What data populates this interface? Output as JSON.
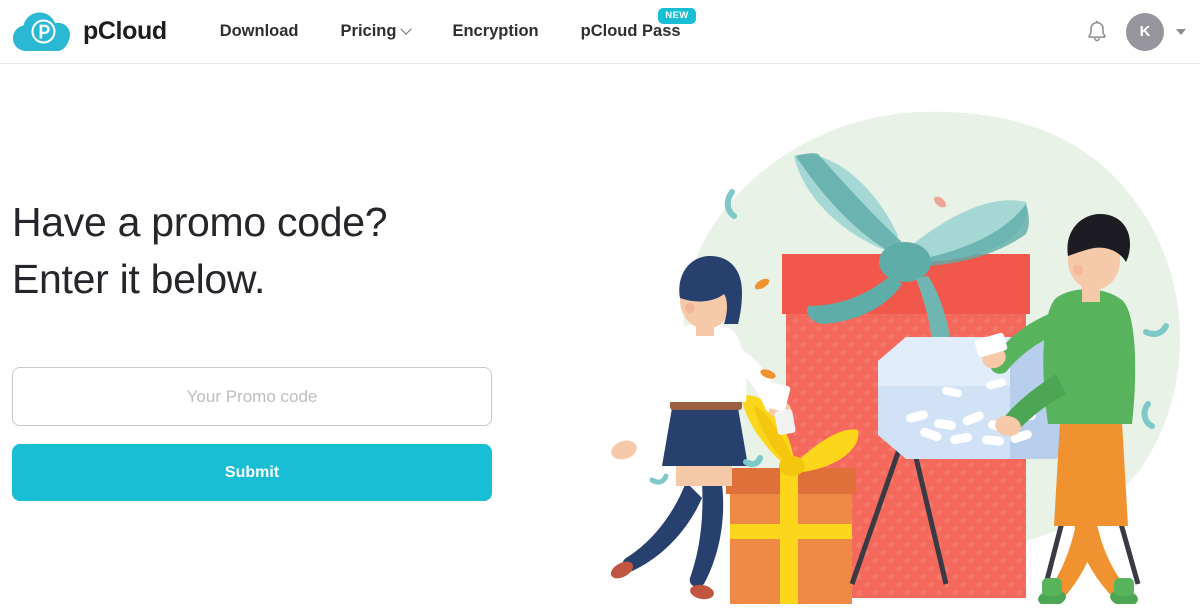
{
  "header": {
    "brand": {
      "name": "pCloud",
      "logo_icon": "pcloud-cloud-logo",
      "color": "#17bed4"
    },
    "nav": [
      {
        "label": "Download",
        "icon": null,
        "badge": null
      },
      {
        "label": "Pricing",
        "icon": "chevron-down-icon",
        "badge": null
      },
      {
        "label": "Encryption",
        "icon": null,
        "badge": null
      },
      {
        "label": "pCloud Pass",
        "icon": null,
        "badge": "NEW"
      }
    ],
    "notifications_icon": "bell-icon",
    "avatar": {
      "initial": "K",
      "color": "#95959b"
    },
    "account_caret_icon": "caret-down-icon"
  },
  "main": {
    "headline_line1": "Have a promo code?",
    "headline_line2": "Enter it below.",
    "promo_input": {
      "value": "",
      "placeholder": "Your Promo code"
    },
    "submit_label": "Submit"
  },
  "illustration": {
    "name": "promo-gift-raffle-illustration",
    "background_blob_color": "#e8f2e6",
    "palette": {
      "teal_bow": "#a5d8d4",
      "teal_bow_dark": "#5fada9",
      "red_box": "#f2574b",
      "red_box_body": "#f4695c",
      "orange_box": "#ef8a46",
      "orange_box_dark": "#e0703a",
      "yellow_ribbon": "#fcd61b",
      "blue_drum": "#c9dcf5",
      "blue_drum_dark": "#a9c4ea",
      "green_sweater": "#57b35c",
      "orange_pants": "#f0922f",
      "navy": "#27406e",
      "white": "#ffffff",
      "skin": "#f6c9a8"
    }
  },
  "colors": {
    "accent": "#17bed4",
    "text": "#25252b",
    "muted": "#bdbdc2",
    "border": "#c9c9cc",
    "header_border": "#e8e8ea"
  }
}
